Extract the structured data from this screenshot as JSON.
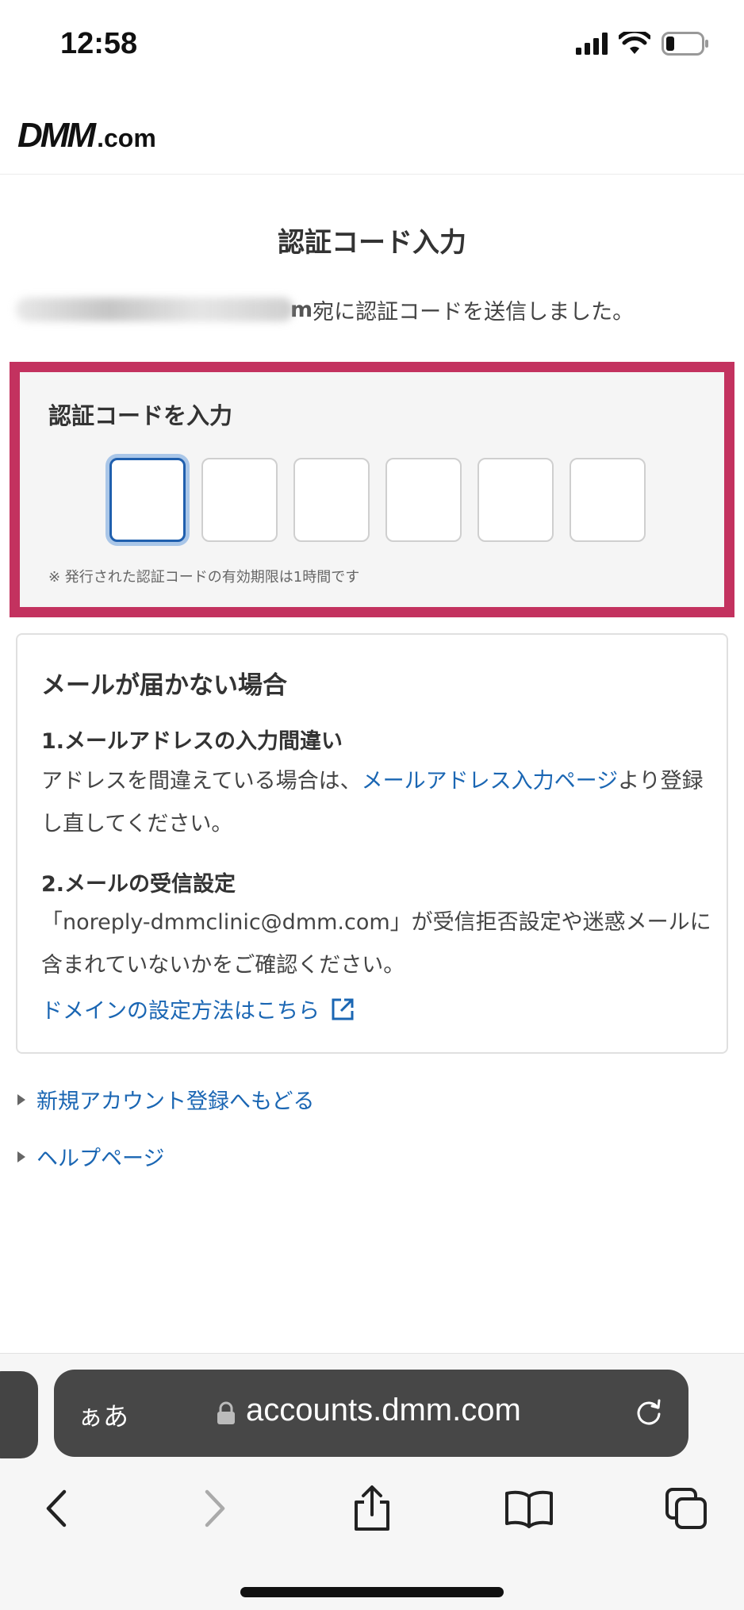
{
  "status_bar": {
    "time": "12:58"
  },
  "header": {
    "logo_main": "DMM",
    "logo_suffix": ".com"
  },
  "page": {
    "title": "認証コード入力",
    "sent_suffix": "m",
    "sent_message": "宛に認証コードを送信しました。"
  },
  "code_entry": {
    "label": "認証コードを入力",
    "cells": [
      "",
      "",
      "",
      "",
      "",
      ""
    ],
    "note": "※ 発行された認証コードの有効期限は1時間です"
  },
  "help": {
    "title": "メールが届かない場合",
    "item1_heading": "1.メールアドレスの入力間違い",
    "item1_text_before": "アドレスを間違えている場合は、",
    "item1_link": "メールアドレス入力ページ",
    "item1_text_after": "より登録し直してください。",
    "item2_heading": "2.メールの受信設定",
    "item2_text": "「noreply-dmmclinic@dmm.com」が受信拒否設定や迷惑メールに含まれていないかをご確認ください。",
    "domain_link": "ドメインの設定方法はこちら"
  },
  "nav_links": {
    "back_to_signup": "新規アカウント登録へもどる",
    "help_page": "ヘルプページ"
  },
  "browser": {
    "aa_label": "ぁあ",
    "url": "accounts.dmm.com"
  },
  "colors": {
    "highlight_border": "#c3325f",
    "link": "#1a66b3",
    "focus": "#1f5fae"
  }
}
